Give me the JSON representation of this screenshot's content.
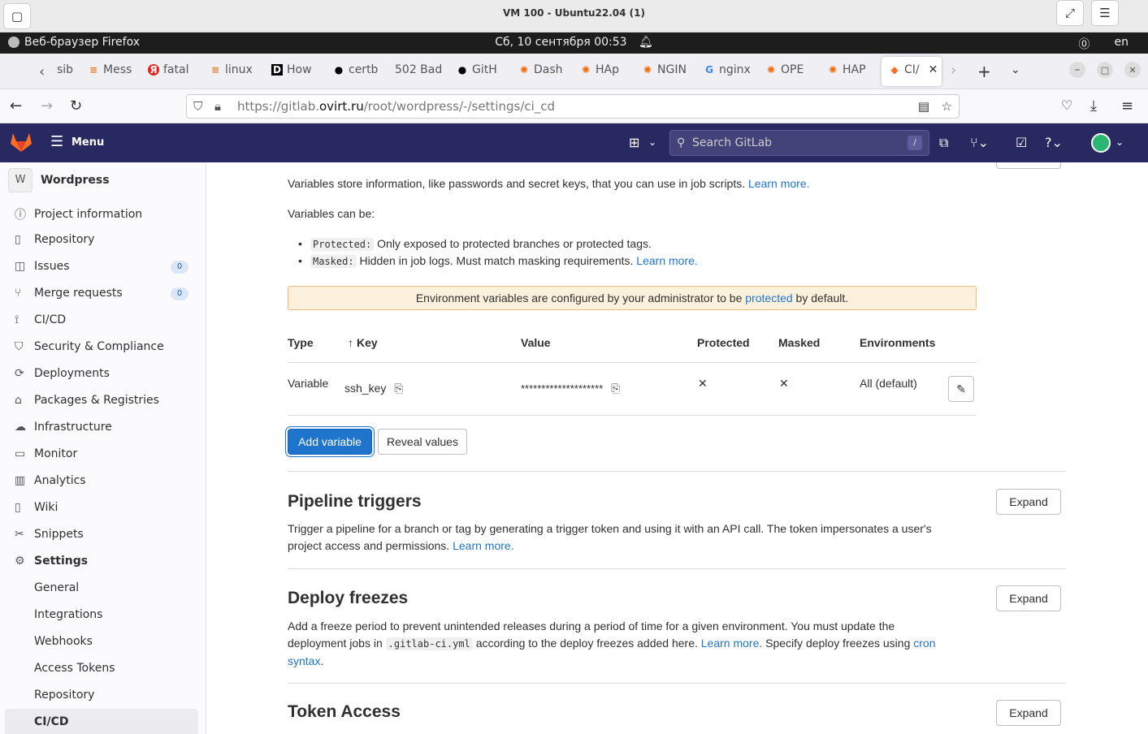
{
  "vm_window": {
    "title": "VM 100 - Ubuntu22.04 (1)"
  },
  "gnome_panel": {
    "app_name": "Веб-браузер Firefox",
    "clock": "Сб, 10 сентября  00:53",
    "keyboard_layout": "en"
  },
  "browser": {
    "tabs": [
      {
        "label": "sib",
        "icon": "stackoverflow-icon"
      },
      {
        "label": "Mess",
        "icon": "stackoverflow-icon"
      },
      {
        "label": "fatal",
        "icon": "yandex-icon"
      },
      {
        "label": "linux",
        "icon": "stackoverflow-icon"
      },
      {
        "label": "How",
        "icon": "dev-icon"
      },
      {
        "label": "certb",
        "icon": "github-icon"
      },
      {
        "label": "502 Bad",
        "icon": ""
      },
      {
        "label": "GitH",
        "icon": "github-icon"
      },
      {
        "label": "Dash",
        "icon": "grafana-icon"
      },
      {
        "label": "HAp",
        "icon": "grafana-icon"
      },
      {
        "label": "NGIN",
        "icon": "grafana-icon"
      },
      {
        "label": "nginx",
        "icon": "google-icon"
      },
      {
        "label": "OPE",
        "icon": "grafana-icon"
      },
      {
        "label": "HAP",
        "icon": "grafana-icon"
      },
      {
        "label": "CI/",
        "icon": "gitlab-icon",
        "active": true
      }
    ],
    "url_scheme": "https://gitlab.",
    "url_host": "ovirt.ru",
    "url_path": "/root/wordpress/-/settings/ci_cd"
  },
  "gitlab_header": {
    "menu_label": "Menu",
    "search_placeholder": "Search GitLab",
    "search_shortcut": "/"
  },
  "sidebar": {
    "project_initial": "W",
    "project_name": "Wordpress",
    "items": [
      {
        "label": "Project information",
        "icon": "info-icon"
      },
      {
        "label": "Repository",
        "icon": "doc-icon"
      },
      {
        "label": "Issues",
        "icon": "issues-icon",
        "badge": "0"
      },
      {
        "label": "Merge requests",
        "icon": "merge-icon",
        "badge": "0"
      },
      {
        "label": "CI/CD",
        "icon": "rocket-icon"
      },
      {
        "label": "Security & Compliance",
        "icon": "shield-icon"
      },
      {
        "label": "Deployments",
        "icon": "deploy-icon"
      },
      {
        "label": "Packages & Registries",
        "icon": "package-icon"
      },
      {
        "label": "Infrastructure",
        "icon": "cloud-icon"
      },
      {
        "label": "Monitor",
        "icon": "monitor-icon"
      },
      {
        "label": "Analytics",
        "icon": "chart-icon"
      },
      {
        "label": "Wiki",
        "icon": "book-icon"
      },
      {
        "label": "Snippets",
        "icon": "scissors-icon"
      },
      {
        "label": "Settings",
        "icon": "settings-icon"
      }
    ],
    "settings_subitems": [
      "General",
      "Integrations",
      "Webhooks",
      "Access Tokens",
      "Repository",
      "CI/CD"
    ]
  },
  "variables": {
    "intro": "Variables store information, like passwords and secret keys, that you can use in job scripts.",
    "learn_more": "Learn more.",
    "can_be": "Variables can be:",
    "protected_code": "Protected:",
    "protected_desc": "Only exposed to protected branches or protected tags.",
    "masked_code": "Masked:",
    "masked_desc": "Hidden in job logs. Must match masking requirements.",
    "alert_before": "Environment variables are configured by your administrator to be",
    "alert_link": "protected",
    "alert_after": "by default.",
    "columns": [
      "Type",
      "Key",
      "Value",
      "Protected",
      "Masked",
      "Environments"
    ],
    "rows": [
      {
        "type": "Variable",
        "key": "ssh_key",
        "value": "********************",
        "protected": "✕",
        "masked": "✕",
        "environments": "All (default)"
      }
    ],
    "add_button": "Add variable",
    "reveal_button": "Reveal values"
  },
  "sections": [
    {
      "title": "Pipeline triggers",
      "desc": "Trigger a pipeline for a branch or tag by generating a trigger token and using it with an API call. The token impersonates a user's project access and permissions.",
      "link": "Learn more.",
      "expand": "Expand"
    },
    {
      "title": "Deploy freezes",
      "desc_before": "Add a freeze period to prevent unintended releases during a period of time for a given environment. You must update the deployment jobs in",
      "desc_code": ".gitlab-ci.yml",
      "desc_mid": "according to the deploy freezes added here.",
      "link": "Learn more.",
      "desc_after": "Specify deploy freezes using",
      "link2": "cron syntax",
      "expand": "Expand"
    },
    {
      "title": "Token Access",
      "expand": "Expand"
    }
  ],
  "colors": {
    "gitlab_nav": "#292961",
    "link": "#1f75cb",
    "primary_button": "#1f75cb",
    "alert_bg": "#fdf1dd"
  }
}
